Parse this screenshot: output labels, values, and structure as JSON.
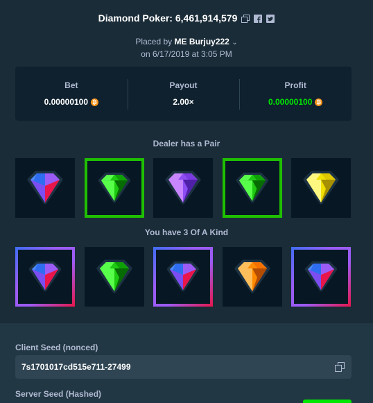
{
  "header": {
    "title": "Diamond Poker: 6,461,914,579"
  },
  "meta": {
    "placed_by_prefix": "Placed by",
    "user_prefix": "ME",
    "username": "Burjuy222",
    "date_line": "on 6/17/2019 at 3:05 PM"
  },
  "stats": {
    "bet_label": "Bet",
    "bet_value": "0.00000100",
    "payout_label": "Payout",
    "payout_value": "2.00×",
    "profit_label": "Profit",
    "profit_value": "0.00000100",
    "currency_icon": "bitcoin-icon"
  },
  "dealer": {
    "caption": "Dealer has a Pair",
    "gems": [
      {
        "color": "rainbow",
        "highlight": "none"
      },
      {
        "color": "green",
        "highlight": "win"
      },
      {
        "color": "purple",
        "highlight": "none"
      },
      {
        "color": "green",
        "highlight": "win"
      },
      {
        "color": "yellow",
        "highlight": "none"
      }
    ]
  },
  "player": {
    "caption": "You have 3 Of A Kind",
    "gems": [
      {
        "color": "rainbow",
        "highlight": "win"
      },
      {
        "color": "green",
        "highlight": "none"
      },
      {
        "color": "rainbow",
        "highlight": "win"
      },
      {
        "color": "orange",
        "highlight": "none"
      },
      {
        "color": "rainbow",
        "highlight": "win"
      }
    ]
  },
  "seeds": {
    "client_label": "Client Seed (nonced)",
    "client_value": "7s1701017cd515e711-27499",
    "server_label": "Server Seed (Hashed)"
  },
  "colors": {
    "background": "#1a2c38",
    "panel": "#0f212e",
    "win_border": "#1fbf00",
    "profit_green": "#00e701",
    "bitcoin": "#f7931a"
  }
}
